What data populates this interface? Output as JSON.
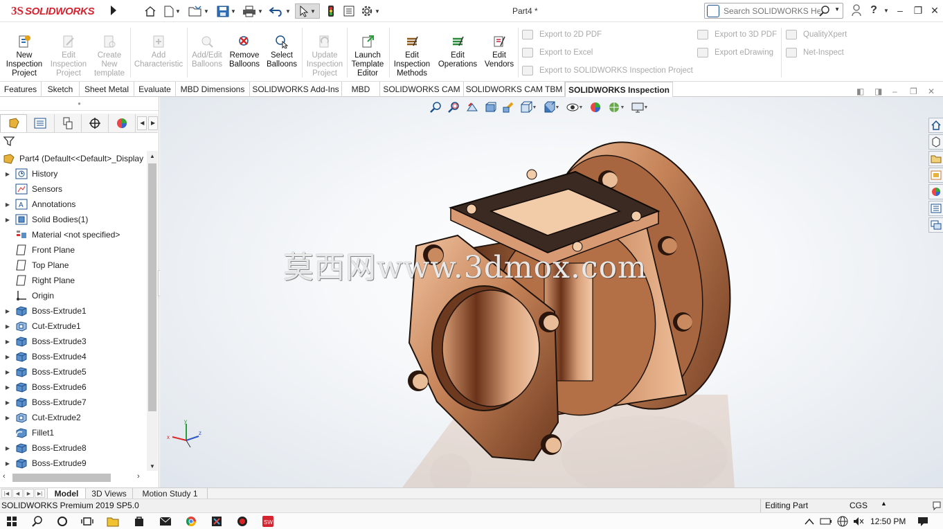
{
  "app": {
    "logo_mark": "3S",
    "logo_text": "SOLIDWORKS",
    "document_title": "Part4 *"
  },
  "quick_access": [
    "home-icon",
    "new-doc-icon",
    "open-folder-icon",
    "save-icon",
    "print-icon",
    "undo-icon",
    "select-cursor-icon",
    "traffic-light-icon",
    "file-properties-icon",
    "options-gear-icon"
  ],
  "search": {
    "placeholder": "Search SOLIDWORKS Help"
  },
  "window_controls": {
    "user": "user-icon",
    "help": "?",
    "minimize": "–",
    "restore": "❐",
    "close": "✕"
  },
  "ribbon": {
    "buttons": [
      {
        "label_lines": [
          "New",
          "Inspection",
          "Project"
        ],
        "enabled": true
      },
      {
        "label_lines": [
          "Edit",
          "Inspection",
          "Project"
        ],
        "enabled": false
      },
      {
        "label_lines": [
          "Create",
          "New",
          "template"
        ],
        "enabled": false
      },
      {
        "label_lines": [
          "Add",
          "Characteristic"
        ],
        "enabled": false
      },
      {
        "label_lines": [
          "Add/Edit",
          "Balloons"
        ],
        "enabled": false
      },
      {
        "label_lines": [
          "Remove",
          "Balloons"
        ],
        "enabled": true
      },
      {
        "label_lines": [
          "Select",
          "Balloons"
        ],
        "enabled": true
      },
      {
        "label_lines": [
          "Update",
          "Inspection",
          "Project"
        ],
        "enabled": false
      },
      {
        "label_lines": [
          "Launch",
          "Template",
          "Editor"
        ],
        "enabled": true
      },
      {
        "label_lines": [
          "Edit",
          "Inspection",
          "Methods"
        ],
        "enabled": true
      },
      {
        "label_lines": [
          "Edit",
          "Operations"
        ],
        "enabled": true
      },
      {
        "label_lines": [
          "Edit",
          "Vendors"
        ],
        "enabled": true
      }
    ],
    "small_buttons": {
      "export_2d_pdf": "Export to 2D PDF",
      "export_excel": "Export to Excel",
      "export_sw_inspection": "Export to SOLIDWORKS Inspection Project",
      "export_3d_pdf": "Export to 3D PDF",
      "export_edrawing": "Export eDrawing",
      "qualityxpert": "QualityXpert",
      "net_inspect": "Net-Inspect"
    }
  },
  "command_tabs": [
    "Features",
    "Sketch",
    "Sheet Metal",
    "Evaluate",
    "MBD Dimensions",
    "SOLIDWORKS Add-Ins",
    "MBD",
    "SOLIDWORKS CAM",
    "SOLIDWORKS CAM TBM",
    "SOLIDWORKS Inspection"
  ],
  "active_command_tab": "SOLIDWORKS Inspection",
  "feature_tree": {
    "root": "Part4  (Default<<Default>_Display",
    "items": [
      {
        "label": "History",
        "icon": "history-icon",
        "expandable": true
      },
      {
        "label": "Sensors",
        "icon": "sensors-icon",
        "expandable": false
      },
      {
        "label": "Annotations",
        "icon": "annotations-icon",
        "expandable": true
      },
      {
        "label": "Solid Bodies(1)",
        "icon": "solid-bodies-icon",
        "expandable": true
      },
      {
        "label": "Material <not specified>",
        "icon": "material-icon",
        "expandable": false
      },
      {
        "label": "Front Plane",
        "icon": "plane-icon",
        "expandable": false
      },
      {
        "label": "Top Plane",
        "icon": "plane-icon",
        "expandable": false
      },
      {
        "label": "Right Plane",
        "icon": "plane-icon",
        "expandable": false
      },
      {
        "label": "Origin",
        "icon": "origin-icon",
        "expandable": false
      },
      {
        "label": "Boss-Extrude1",
        "icon": "boss-extrude-icon",
        "expandable": true
      },
      {
        "label": "Cut-Extrude1",
        "icon": "cut-extrude-icon",
        "expandable": true
      },
      {
        "label": "Boss-Extrude3",
        "icon": "boss-extrude-icon",
        "expandable": true
      },
      {
        "label": "Boss-Extrude4",
        "icon": "boss-extrude-icon",
        "expandable": true
      },
      {
        "label": "Boss-Extrude5",
        "icon": "boss-extrude-icon",
        "expandable": true
      },
      {
        "label": "Boss-Extrude6",
        "icon": "boss-extrude-icon",
        "expandable": true
      },
      {
        "label": "Boss-Extrude7",
        "icon": "boss-extrude-icon",
        "expandable": true
      },
      {
        "label": "Cut-Extrude2",
        "icon": "cut-extrude-icon",
        "expandable": true
      },
      {
        "label": "Fillet1",
        "icon": "fillet-icon",
        "expandable": false
      },
      {
        "label": "Boss-Extrude8",
        "icon": "boss-extrude-icon",
        "expandable": true
      },
      {
        "label": "Boss-Extrude9",
        "icon": "boss-extrude-icon",
        "expandable": true
      }
    ]
  },
  "watermark": "莫西网www.3dmox.com",
  "bottom_tabs": [
    "Model",
    "3D Views",
    "Motion Study 1"
  ],
  "active_bottom_tab": "Model",
  "status": {
    "product": "SOLIDWORKS Premium 2019 SP5.0",
    "mode": "Editing Part",
    "units": "CGS"
  },
  "taskbar": {
    "time": "12:50 PM"
  },
  "colors": {
    "brand": "#d5232f",
    "part_copper": "#b8774f",
    "part_edge": "#1d120c",
    "gasket": "#3a2a22"
  }
}
